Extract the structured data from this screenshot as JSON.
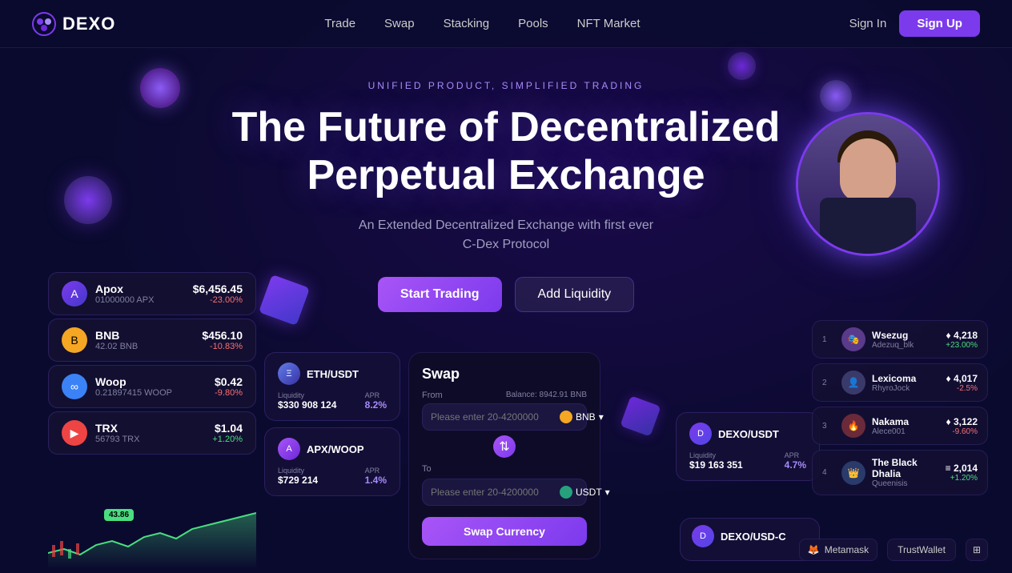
{
  "navbar": {
    "logo_text": "DEXO",
    "nav_items": [
      "Trade",
      "Swap",
      "Stacking",
      "Pools",
      "NFT Market"
    ],
    "signin_label": "Sign In",
    "signup_label": "Sign Up"
  },
  "hero": {
    "subtitle": "UNIFIED PRODUCT, SIMPLIFIED TRADING",
    "title_line1": "The Future of Decentralized",
    "title_line2": "Perpetual Exchange",
    "description": "An Extended Decentralized Exchange with first ever\nC-Dex Protocol",
    "cta_start": "Start Trading",
    "cta_liquidity": "Add Liquidity"
  },
  "assets": [
    {
      "name": "Apox",
      "amount": "01000000 APX",
      "price": "$6,456.45",
      "change": "-23.00%",
      "change_pos": false,
      "color": "#7c3aed"
    },
    {
      "name": "BNB",
      "amount": "42.02 BNB",
      "price": "$456.10",
      "change": "-10.83%",
      "change_pos": false,
      "color": "#f5a623"
    },
    {
      "name": "Woop",
      "amount": "0.21897415 WOOP",
      "price": "$0.42",
      "change": "-9.80%",
      "change_pos": false,
      "color": "#60a5fa"
    },
    {
      "name": "TRX",
      "amount": "56793 TRX",
      "price": "$1.04",
      "change": "+1.20%",
      "change_pos": true,
      "color": "#ef4444"
    }
  ],
  "chart": {
    "badge": "43.86"
  },
  "pools": [
    {
      "name": "ETH/USDT",
      "liquidity_label": "Liquidity",
      "liquidity_value": "$330 908 124",
      "apr_label": "APR",
      "apr_value": "8.2%"
    },
    {
      "name": "APX/WOOP",
      "liquidity_label": "Liquidity",
      "liquidity_value": "$729 214",
      "apr_label": "APR",
      "apr_value": "1.4%"
    }
  ],
  "swap": {
    "title": "Swap",
    "from_label": "From",
    "balance_label": "Balance: 8942.91 BNB",
    "from_placeholder": "Please enter 20-4200000",
    "from_token": "BNB",
    "to_label": "To",
    "to_placeholder": "Please enter 20-4200000",
    "to_token": "USDT",
    "swap_btn": "Swap Currency"
  },
  "right_pool": {
    "name": "DEXO/USDT",
    "liquidity_label": "Liquidity",
    "liquidity_value": "$19 163 351",
    "apr_label": "APR",
    "apr_value": "4.7%"
  },
  "dexo_bottom": {
    "name": "DEXO/USD-C"
  },
  "leaderboard": [
    {
      "rank": "1",
      "name": "Wsezug",
      "handle": "Adezuq_blk",
      "score": "♦ 4,218",
      "change": "+23.00%",
      "pos": true,
      "avatar_color": "#4a3a7a"
    },
    {
      "rank": "2",
      "name": "Lexicoma",
      "handle": "RhyroJock",
      "score": "♦ 4,017",
      "change": "-2.5%",
      "pos": false,
      "avatar_color": "#3a3a6a"
    },
    {
      "rank": "3",
      "name": "Nakama",
      "handle": "Alece001",
      "score": "♦ 3,122",
      "change": "-9.60%",
      "pos": false,
      "avatar_color": "#5a2a3a"
    },
    {
      "rank": "4",
      "name": "The Black Dhalia",
      "handle": "Queenisis",
      "score": "≡ 2,014",
      "change": "+1.20%",
      "pos": true,
      "avatar_color": "#2a3a5a"
    }
  ],
  "wallets": [
    "Metamask",
    "TrustWallet"
  ],
  "wallet_icon": "🦊"
}
